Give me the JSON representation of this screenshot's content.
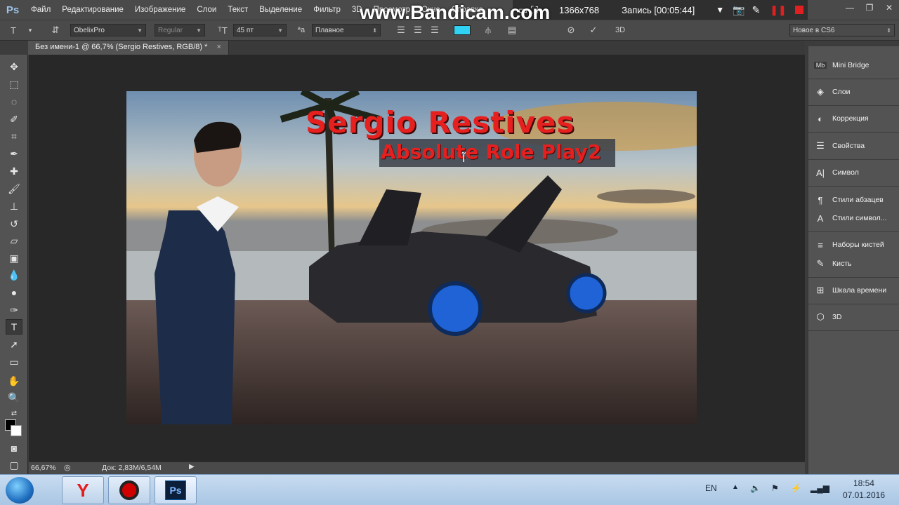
{
  "app": {
    "logo": "Ps"
  },
  "menu": [
    "Файл",
    "Редактирование",
    "Изображение",
    "Слои",
    "Текст",
    "Выделение",
    "Фильтр",
    "3D",
    "Просмотр",
    "Окно",
    "Справка"
  ],
  "recorder": {
    "watermark": "www.Bandicam.com",
    "resolution": "1366x768",
    "record_label": "Запись [00:05:44]"
  },
  "options": {
    "font_family": "ObelixPro",
    "font_style": "Regular",
    "font_size": "45 пт",
    "aa_label": "ªa",
    "antialias": "Плавное",
    "workspace": "Новое в CS6",
    "threed": "3D"
  },
  "document": {
    "tab_title": "Без имени-1 @ 66,7% (Sergio Restives, RGB/8) *",
    "close": "×"
  },
  "canvas": {
    "headline": "Sergio Restives",
    "subline": "Absolute Role Play2",
    "cursor": "Ĩ"
  },
  "status": {
    "zoom": "66,67%",
    "doc": "Док: 2,83M/6,54M"
  },
  "panels": [
    {
      "icon": "Mb",
      "label": "Mini Bridge"
    },
    {
      "icon": "◈",
      "label": "Слои"
    },
    {
      "icon": "◐",
      "label": "Коррекция"
    },
    {
      "icon": "☰",
      "label": "Свойства"
    },
    {
      "icon": "A|",
      "label": "Символ"
    },
    {
      "icon": "¶",
      "label": "Стили абзацев"
    },
    {
      "icon": "A",
      "label": "Стили символ..."
    },
    {
      "icon": "≡",
      "label": "Наборы кистей"
    },
    {
      "icon": "✎",
      "label": "Кисть"
    },
    {
      "icon": "⊞",
      "label": "Шкала времени"
    },
    {
      "icon": "⬡",
      "label": "3D"
    }
  ],
  "taskbar": {
    "lang": "EN",
    "time": "18:54",
    "date": "07.01.2016",
    "ps_label": "Ps"
  }
}
